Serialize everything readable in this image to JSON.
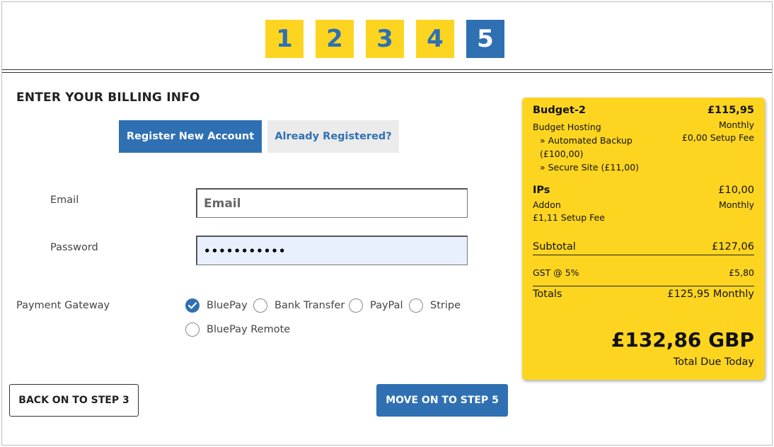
{
  "steps": [
    "1",
    "2",
    "3",
    "4",
    "5"
  ],
  "active_step": "5",
  "heading": "ENTER YOUR BILLING INFO",
  "tabs": {
    "register": "Register New Account",
    "login": "Already Registered?"
  },
  "form": {
    "email_label": "Email",
    "email_placeholder": "Email",
    "email_value": "",
    "password_label": "Password",
    "password_value": "•••••••••••",
    "gateway_label": "Payment Gateway"
  },
  "gateways": {
    "bluepay": "BluePay",
    "bank_transfer": "Bank Transfer",
    "paypal": "PayPal",
    "stripe": "Stripe",
    "bluepay_remote": "BluePay Remote",
    "selected": "BluePay"
  },
  "buttons": {
    "back": "BACK ON TO STEP 3",
    "next": "MOVE ON TO STEP 5"
  },
  "summary": {
    "product_name": "Budget-2",
    "product_price": "£115,95",
    "product_group": "Budget Hosting",
    "product_cycle": "Monthly",
    "addon_1_line1": "» Automated Backup",
    "addon_1_line2": "(£100,00)",
    "product_setup": "£0,00 Setup Fee",
    "addon_2": "» Secure Site (£11,00)",
    "ips_name": "IPs",
    "ips_price": "£10,00",
    "ips_type": "Addon",
    "ips_cycle": "Monthly",
    "ips_setup": "£1,11 Setup Fee",
    "subtotal_label": "Subtotal",
    "subtotal_value": "£127,06",
    "tax_label": "GST @ 5%",
    "tax_value": "£5,80",
    "totals_label": "Totals",
    "totals_value": "£125,95 Monthly",
    "total_due": "£132,86 GBP",
    "total_due_label": "Total Due Today"
  },
  "colors": {
    "accent_blue": "#2f70b3",
    "accent_yellow": "#fdd520"
  }
}
